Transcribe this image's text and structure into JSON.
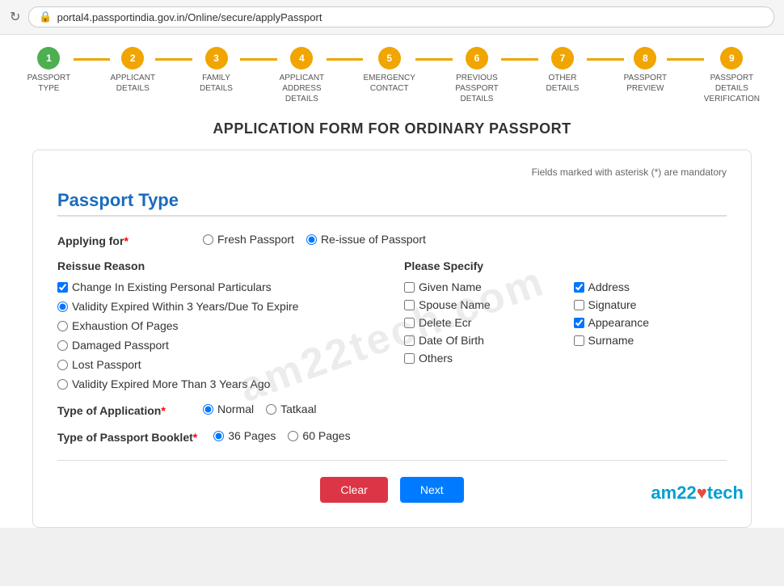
{
  "browser": {
    "url": "portal4.passportindia.gov.in/Online/secure/applyPassport"
  },
  "page_title": "APPLICATION FORM FOR ORDINARY PASSPORT",
  "mandatory_note": "Fields marked with asterisk (*) are mandatory",
  "steps": [
    {
      "number": "1",
      "label": "PASSPORT TYPE",
      "state": "completed"
    },
    {
      "number": "2",
      "label": "APPLICANT\nDETAILS",
      "state": "active"
    },
    {
      "number": "3",
      "label": "FAMILY DETAILS",
      "state": "pending"
    },
    {
      "number": "4",
      "label": "APPLICANT\nADDRESS DETAILS",
      "state": "pending"
    },
    {
      "number": "5",
      "label": "EMERGENCY\nCONTACT",
      "state": "pending"
    },
    {
      "number": "6",
      "label": "PREVIOUS\nPASSPORT DETAILS",
      "state": "pending"
    },
    {
      "number": "7",
      "label": "OTHER DETAILS",
      "state": "pending"
    },
    {
      "number": "8",
      "label": "PASSPORT\nPREVIEW",
      "state": "pending"
    },
    {
      "number": "9",
      "label": "PASSPORT DETAILS\nVERIFICATION",
      "state": "pending"
    }
  ],
  "section_title": "Passport Type",
  "applying_for": {
    "label": "Applying for",
    "required": true,
    "options": [
      {
        "value": "fresh",
        "label": "Fresh Passport",
        "checked": false
      },
      {
        "value": "reissue",
        "label": "Re-issue of Passport",
        "checked": true
      }
    ]
  },
  "reissue_reason": {
    "title": "Reissue Reason",
    "options": [
      {
        "label": "Change In Existing Personal Particulars",
        "checked": true,
        "type": "checkbox"
      },
      {
        "label": "Validity Expired Within 3 Years/Due To Expire",
        "checked": true,
        "type": "radio"
      },
      {
        "label": "Exhaustion Of Pages",
        "checked": false,
        "type": "radio"
      },
      {
        "label": "Damaged Passport",
        "checked": false,
        "type": "radio"
      },
      {
        "label": "Lost Passport",
        "checked": false,
        "type": "radio"
      },
      {
        "label": "Validity Expired More Than 3 Years Ago",
        "checked": false,
        "type": "radio"
      }
    ]
  },
  "please_specify": {
    "title": "Please Specify",
    "options": [
      {
        "label": "Given Name",
        "checked": false
      },
      {
        "label": "Address",
        "checked": true
      },
      {
        "label": "Spouse Name",
        "checked": false
      },
      {
        "label": "Signature",
        "checked": false
      },
      {
        "label": "Delete Ecr",
        "checked": false
      },
      {
        "label": "Appearance",
        "checked": true
      },
      {
        "label": "Date Of Birth",
        "checked": false
      },
      {
        "label": "Surname",
        "checked": false
      },
      {
        "label": "Others",
        "checked": false
      }
    ]
  },
  "type_of_application": {
    "label": "Type of Application",
    "required": true,
    "options": [
      {
        "value": "normal",
        "label": "Normal",
        "checked": true
      },
      {
        "value": "tatkaal",
        "label": "Tatkaal",
        "checked": false
      }
    ]
  },
  "type_of_passport_booklet": {
    "label": "Type of Passport Booklet",
    "required": true,
    "options": [
      {
        "value": "36",
        "label": "36 Pages",
        "checked": true
      },
      {
        "value": "60",
        "label": "60 Pages",
        "checked": false
      }
    ]
  },
  "buttons": {
    "clear": "Clear",
    "next": "Next"
  },
  "watermark": "am22tech.com",
  "am22tech_logo": "am22"
}
